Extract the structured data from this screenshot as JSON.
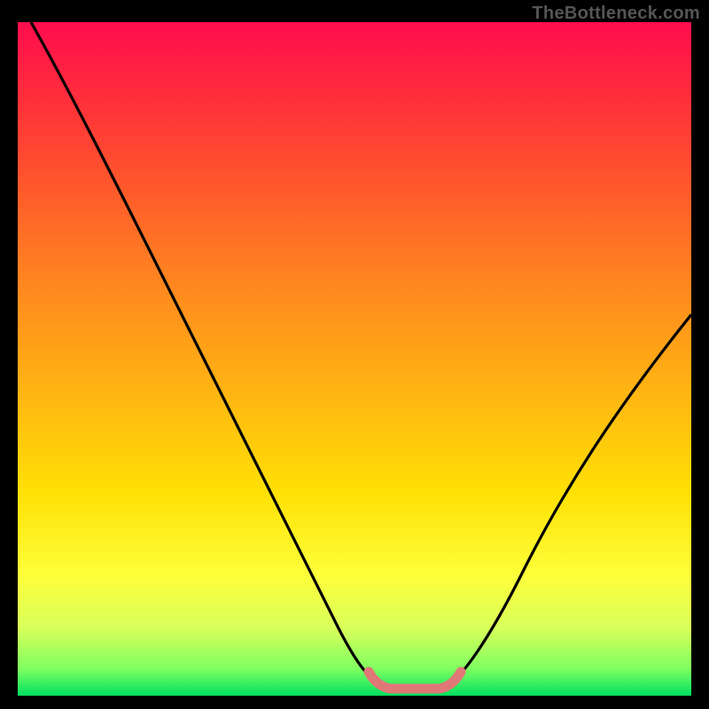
{
  "watermark": "TheBottleneck.com",
  "chart_data": {
    "type": "line",
    "title": "",
    "xlabel": "",
    "ylabel": "",
    "xlim": [
      0,
      100
    ],
    "ylim": [
      0,
      100
    ],
    "x": [
      2,
      10,
      20,
      30,
      40,
      46,
      50,
      54,
      58,
      62,
      68,
      76,
      84,
      92,
      100
    ],
    "values": [
      100,
      86,
      70,
      53,
      35,
      20,
      10,
      3,
      1,
      1,
      3,
      12,
      25,
      40,
      56
    ],
    "highlight_region": {
      "x_start": 52,
      "x_end": 64,
      "y": 1
    },
    "background_gradient": [
      "#ff0d4d",
      "#ffe105",
      "#00e060"
    ],
    "curve_color": "#000000",
    "highlight_color": "#e07878"
  }
}
